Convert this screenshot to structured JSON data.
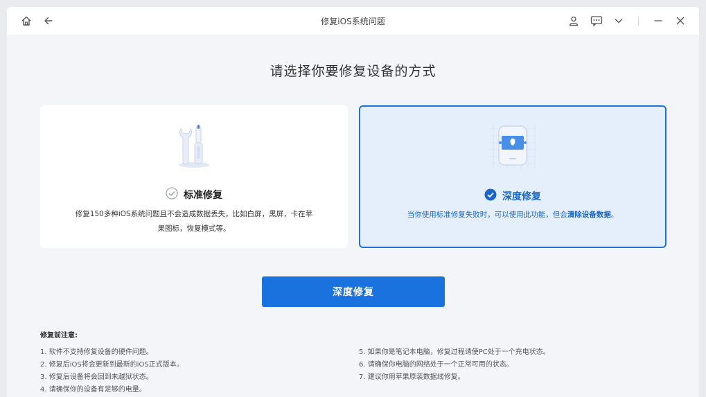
{
  "window": {
    "title": "修复iOS系统问题"
  },
  "icons": {
    "home": "home-icon",
    "back": "back-arrow-icon",
    "user": "user-icon",
    "feedback": "feedback-icon",
    "dropdown": "chevron-down-icon",
    "minimize": "minimize-icon",
    "close": "close-icon",
    "standard": "wrench-screwdriver-icon",
    "deep": "phone-repair-icon",
    "check_outline": "check-circle-outline-icon",
    "check_filled": "check-circle-filled-icon"
  },
  "colors": {
    "accent": "#1972dd",
    "selected_bg": "#e5effb",
    "selected_border": "#1f73d8"
  },
  "heading": "请选择你要修复设备的方式",
  "modes": {
    "standard": {
      "title": "标准修复",
      "desc": "修复150多种iOS系统问题且不会造成数据丢失，比如白屏，黑屏，卡在苹果图标，恢复模式等。",
      "selected": false
    },
    "deep": {
      "title": "深度修复",
      "desc_prefix": "当你使用标准修复失败时，可以使用此功能，但会",
      "desc_bold": "清除设备数据",
      "desc_suffix": "。",
      "selected": true
    }
  },
  "primary_button": "深度修复",
  "notes": {
    "title": "修复前注意:",
    "left": [
      "1.  软件不支持修复设备的硬件问题。",
      "2.  修复后iOS将会更新到最新的iOS正式版本。",
      "3.  修复后设备将会回到未越狱状态。",
      "4.  请确保你的设备有足够的电量。"
    ],
    "right": [
      "5.  如果你是笔记本电脑，修复过程请使PC处于一个充电状态。",
      "6.  请确保你电脑的网络处于一个正常可用的状态。",
      "7.  建议你用苹果原装数据线修复。"
    ]
  }
}
